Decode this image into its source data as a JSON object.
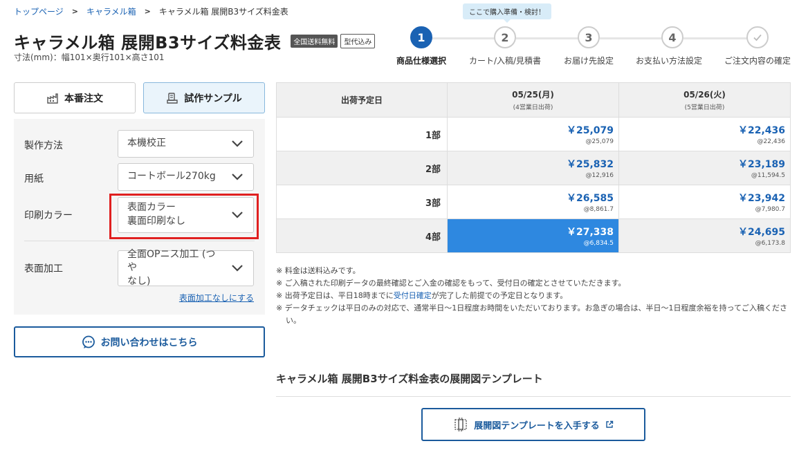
{
  "breadcrumb": {
    "home": "トップページ",
    "category": "キャラメル箱",
    "current": "キャラメル箱 展開B3サイズ料金表"
  },
  "title": "キャラメル箱 展開B3サイズ料金表",
  "badges": {
    "shipping": "全国送料無料",
    "mold": "型代込み"
  },
  "dimensions": "寸法(mm)：幅101×奥行101×高さ101",
  "steps": {
    "tooltip": "ここで購入準備・検討！",
    "items": [
      {
        "num": "1",
        "label": "商品仕様選択"
      },
      {
        "num": "2",
        "label": "カート/入稿/見積書"
      },
      {
        "num": "3",
        "label": "お届け先設定"
      },
      {
        "num": "4",
        "label": "お支払い方法設定"
      },
      {
        "num": "",
        "label": "ご注文内容の確定"
      }
    ],
    "active_index": 0
  },
  "order_type": {
    "production": "本番注文",
    "sample": "試作サンプル",
    "selected": "sample"
  },
  "options": {
    "method": {
      "label": "製作方法",
      "value": "本機校正"
    },
    "paper": {
      "label": "用紙",
      "value": "コートボール270kg"
    },
    "color": {
      "label": "印刷カラー",
      "value_line1": "表面カラー",
      "value_line2": "裏面印刷なし"
    },
    "finish": {
      "label": "表面加工",
      "value_line1": "全面OPニス加工 (つや",
      "value_line2": "なし)"
    },
    "no_finish_link": "表面加工なしにする"
  },
  "contact_button": "お問い合わせはこちら",
  "price_table": {
    "header": "出荷予定日",
    "dates": [
      {
        "date": "05/25(月)",
        "sub": "(4営業日出荷)"
      },
      {
        "date": "05/26(火)",
        "sub": "(5営業日出荷)"
      }
    ],
    "rows": [
      {
        "qty": "1部",
        "p1": "￥25,079",
        "u1": "@25,079",
        "p2": "￥22,436",
        "u2": "@22,436"
      },
      {
        "qty": "2部",
        "p1": "￥25,832",
        "u1": "@12,916",
        "p2": "￥23,189",
        "u2": "@11,594.5"
      },
      {
        "qty": "3部",
        "p1": "￥26,585",
        "u1": "@8,861.7",
        "p2": "￥23,942",
        "u2": "@7,980.7"
      },
      {
        "qty": "4部",
        "p1": "￥27,338",
        "u1": "@6,834.5",
        "p2": "￥24,695",
        "u2": "@6,173.8"
      }
    ],
    "selected_cell": "4部 / 05/25(月)"
  },
  "notes": {
    "n1": "※ 料金は送料込みです。",
    "n2": "※ ご入稿された印刷データの最終確認とご入金の確認をもって、受付日の確定とさせていただきます。",
    "n3_pre": "※ 出荷予定日は、平日18時までに",
    "n3_link": "受付日確定",
    "n3_post": "が完了した前提での予定日となります。",
    "n4": "※ データチェックは平日のみの対応で、通常半日〜1日程度お時間をいただいております。お急ぎの場合は、半日〜1日程度余裕を持ってご入稿ください。"
  },
  "template": {
    "heading": "キャラメル箱 展開B3サイズ料金表の展開図テンプレート",
    "button": "展開図テンプレートを入手する"
  },
  "colors": {
    "accent": "#1a62b3",
    "selected_cell": "#2e88e0",
    "highlight": "#e02020"
  }
}
